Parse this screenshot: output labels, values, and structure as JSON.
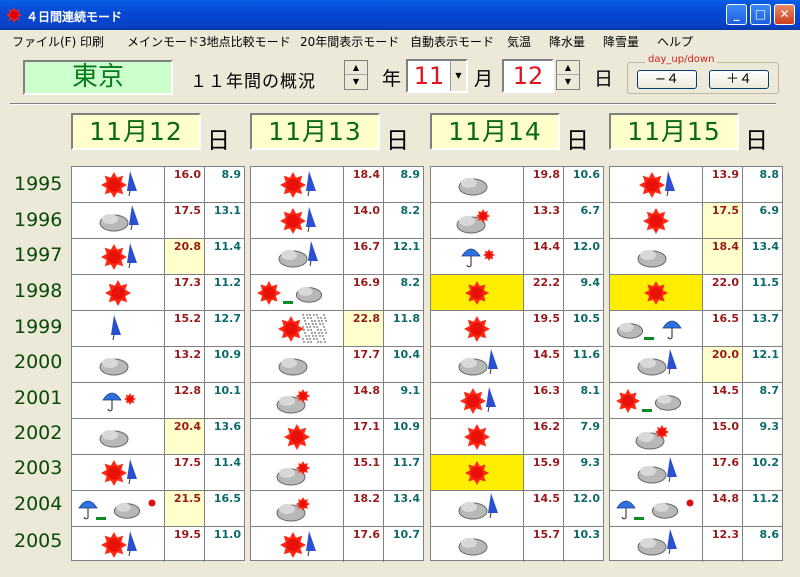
{
  "window": {
    "title": "４日間連続モード"
  },
  "menu": [
    "ファイル(F)",
    "印刷",
    "メインモード",
    "3地点比較モード",
    "20年間表示モード",
    "自動表示モード",
    "気温",
    "降水量",
    "降雪量",
    "ヘルプ"
  ],
  "header": {
    "city": "東京",
    "overview": "１１年間の概況",
    "year_unit": "年",
    "month": "11",
    "month_unit": "月",
    "day": "12",
    "day_unit": "日",
    "day_updown_label": "day_up/down",
    "minus_label": "−４",
    "plus_label": "＋４"
  },
  "years": [
    "1995",
    "1996",
    "1997",
    "1998",
    "1999",
    "2000",
    "2001",
    "2002",
    "2003",
    "2004",
    "2005"
  ],
  "days": [
    {
      "date": "11月12日",
      "entries": [
        {
          "w": "sun-umbrella",
          "max": "16.0",
          "min": "8.9",
          "hl": false
        },
        {
          "w": "cloud-umbrella",
          "max": "17.5",
          "min": "13.1",
          "hl": false
        },
        {
          "w": "sun-umbrella",
          "max": "20.8",
          "min": "11.4",
          "hl": true
        },
        {
          "w": "sun",
          "max": "17.3",
          "min": "11.2",
          "hl": false
        },
        {
          "w": "umbrella",
          "max": "15.2",
          "min": "12.7",
          "hl": false
        },
        {
          "w": "cloud",
          "max": "13.2",
          "min": "10.9",
          "hl": false
        },
        {
          "w": "rain-umbrella",
          "max": "12.8",
          "min": "10.1",
          "hl": false
        },
        {
          "w": "cloud",
          "max": "20.4",
          "min": "13.6",
          "hl": true
        },
        {
          "w": "sun-umbrella",
          "max": "17.5",
          "min": "11.4",
          "hl": false
        },
        {
          "w": "rain-cloud",
          "max": "21.5",
          "min": "16.5",
          "hl": true
        },
        {
          "w": "sun-umbrella",
          "max": "19.5",
          "min": "11.0",
          "hl": false
        }
      ]
    },
    {
      "date": "11月13日",
      "entries": [
        {
          "w": "sun-umbrella",
          "max": "18.4",
          "min": "8.9",
          "hl": false
        },
        {
          "w": "sun-umbrella",
          "max": "14.0",
          "min": "8.2",
          "hl": false
        },
        {
          "w": "cloud-umbrella",
          "max": "16.7",
          "min": "12.1",
          "hl": false
        },
        {
          "w": "sun-cloud",
          "max": "16.9",
          "min": "8.2",
          "hl": false
        },
        {
          "w": "sun-dots",
          "max": "22.8",
          "min": "11.8",
          "hl": true
        },
        {
          "w": "cloud",
          "max": "17.7",
          "min": "10.4",
          "hl": false
        },
        {
          "w": "cloud-sun",
          "max": "14.8",
          "min": "9.1",
          "hl": false
        },
        {
          "w": "sun",
          "max": "17.1",
          "min": "10.9",
          "hl": false
        },
        {
          "w": "cloud-sun",
          "max": "15.1",
          "min": "11.7",
          "hl": false
        },
        {
          "w": "cloud-sun",
          "max": "18.2",
          "min": "13.4",
          "hl": false
        },
        {
          "w": "sun-umbrella",
          "max": "17.6",
          "min": "10.7",
          "hl": false
        }
      ]
    },
    {
      "date": "11月14日",
      "entries": [
        {
          "w": "cloud",
          "max": "19.8",
          "min": "10.6",
          "hl": false
        },
        {
          "w": "cloud-sun",
          "max": "13.3",
          "min": "6.7",
          "hl": false
        },
        {
          "w": "rain-umbrella",
          "max": "14.4",
          "min": "12.0",
          "hl": false
        },
        {
          "w": "sun-bg",
          "max": "22.2",
          "min": "9.4",
          "hl": false
        },
        {
          "w": "sun",
          "max": "19.5",
          "min": "10.5",
          "hl": false
        },
        {
          "w": "cloud-umbrella",
          "max": "14.5",
          "min": "11.6",
          "hl": false
        },
        {
          "w": "sun-umbrella",
          "max": "16.3",
          "min": "8.1",
          "hl": false
        },
        {
          "w": "sun",
          "max": "16.2",
          "min": "7.9",
          "hl": false
        },
        {
          "w": "sun-bg",
          "max": "15.9",
          "min": "9.3",
          "hl": false
        },
        {
          "w": "cloud-umbrella",
          "max": "14.5",
          "min": "12.0",
          "hl": false
        },
        {
          "w": "cloud",
          "max": "15.7",
          "min": "10.3",
          "hl": false
        }
      ]
    },
    {
      "date": "11月15日",
      "entries": [
        {
          "w": "sun-umbrella",
          "max": "13.9",
          "min": "8.8",
          "hl": false
        },
        {
          "w": "sun",
          "max": "17.5",
          "min": "6.9",
          "hl": true
        },
        {
          "w": "cloud",
          "max": "18.4",
          "min": "13.4",
          "hl": true
        },
        {
          "w": "sun-bg",
          "max": "22.0",
          "min": "11.5",
          "hl": false
        },
        {
          "w": "cloud-rain",
          "max": "16.5",
          "min": "13.7",
          "hl": false
        },
        {
          "w": "cloud-umbrella",
          "max": "20.0",
          "min": "12.1",
          "hl": true
        },
        {
          "w": "sun-cloud",
          "max": "14.5",
          "min": "8.7",
          "hl": false
        },
        {
          "w": "cloud-sun",
          "max": "15.0",
          "min": "9.3",
          "hl": false
        },
        {
          "w": "cloud-umbrella",
          "max": "17.6",
          "min": "10.2",
          "hl": false
        },
        {
          "w": "rain-cloud",
          "max": "14.8",
          "min": "11.2",
          "hl": false
        },
        {
          "w": "cloud-umbrella",
          "max": "12.3",
          "min": "8.6",
          "hl": false
        }
      ]
    }
  ]
}
